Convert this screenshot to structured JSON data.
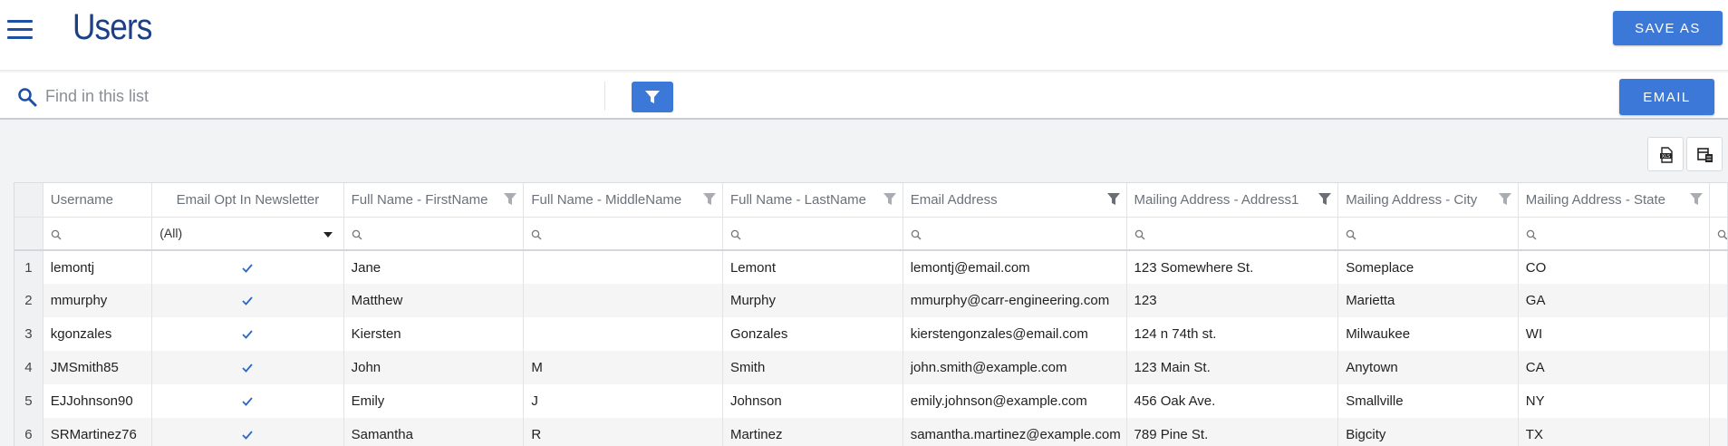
{
  "header": {
    "title": "Users",
    "save_as_label": "SAVE AS"
  },
  "search": {
    "placeholder": "Find in this list",
    "email_label": "EMAIL"
  },
  "grid": {
    "columns": [
      {
        "label": "Username",
        "filter": "none"
      },
      {
        "label": "Email Opt In Newsletter",
        "filter": "none"
      },
      {
        "label": "Full Name - FirstName",
        "filter": "light"
      },
      {
        "label": "Full Name - MiddleName",
        "filter": "light"
      },
      {
        "label": "Full Name - LastName",
        "filter": "light"
      },
      {
        "label": "Email Address",
        "filter": "dark"
      },
      {
        "label": "Mailing Address - Address1",
        "filter": "dark"
      },
      {
        "label": "Mailing Address - City",
        "filter": "light"
      },
      {
        "label": "Mailing Address - State",
        "filter": "light"
      },
      {
        "label": "",
        "filter": "none"
      }
    ],
    "opt_in_filter_value": "(All)",
    "rows": [
      {
        "num": "1",
        "username": "lemontj",
        "opt_in": true,
        "first": "Jane",
        "middle": "",
        "last": "Lemont",
        "email": "lemontj@email.com",
        "address1": "123 Somewhere St.",
        "city": "Someplace",
        "state": "CO"
      },
      {
        "num": "2",
        "username": "mmurphy",
        "opt_in": true,
        "first": "Matthew",
        "middle": "",
        "last": "Murphy",
        "email": "mmurphy@carr-engineering.com",
        "address1": "123",
        "city": "Marietta",
        "state": "GA"
      },
      {
        "num": "3",
        "username": "kgonzales",
        "opt_in": true,
        "first": "Kiersten",
        "middle": "",
        "last": "Gonzales",
        "email": "kierstengonzales@email.com",
        "address1": "124 n 74th st.",
        "city": "Milwaukee",
        "state": "WI"
      },
      {
        "num": "4",
        "username": "JMSmith85",
        "opt_in": true,
        "first": "John",
        "middle": "M",
        "last": "Smith",
        "email": "john.smith@example.com",
        "address1": "123 Main St.",
        "city": "Anytown",
        "state": "CA"
      },
      {
        "num": "5",
        "username": "EJJohnson90",
        "opt_in": true,
        "first": "Emily",
        "middle": "J",
        "last": "Johnson",
        "email": "emily.johnson@example.com",
        "address1": "456 Oak Ave.",
        "city": "Smallville",
        "state": "NY"
      },
      {
        "num": "6",
        "username": "SRMartinez76",
        "opt_in": true,
        "first": "Samantha",
        "middle": "R",
        "last": "Martinez",
        "email": "samantha.martinez@example.com",
        "address1": "789 Pine St.",
        "city": "Bigcity",
        "state": "TX"
      }
    ]
  },
  "icons": {
    "menu": "hamburger-menu-icon",
    "search": "search-icon",
    "filter": "filter-icon",
    "export_xls": "export-xls-icon",
    "column_chooser": "column-chooser-icon",
    "check": "checkmark-icon"
  },
  "colors": {
    "accent": "#3b78d8",
    "title": "#1c3f86",
    "filter_light": "#a9adb3",
    "filter_dark": "#6b6f75"
  }
}
